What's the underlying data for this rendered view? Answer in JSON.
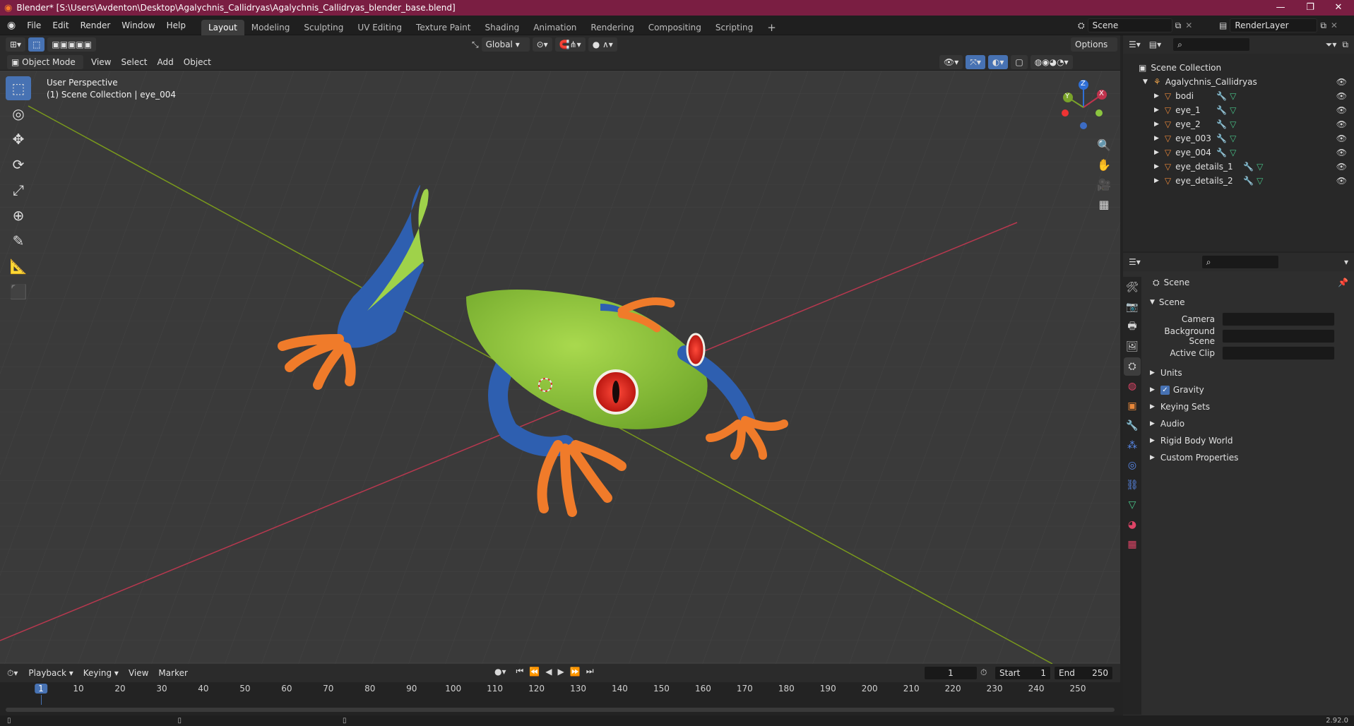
{
  "window": {
    "title": "Blender* [S:\\Users\\Avdenton\\Desktop\\Agalychnis_Callidryas\\Agalychnis_Callidryas_blender_base.blend]",
    "minimize": "—",
    "maximize": "❐",
    "close": "✕"
  },
  "menu": [
    "File",
    "Edit",
    "Render",
    "Window",
    "Help"
  ],
  "workspaces": [
    "Layout",
    "Modeling",
    "Sculpting",
    "UV Editing",
    "Texture Paint",
    "Shading",
    "Animation",
    "Rendering",
    "Compositing",
    "Scripting"
  ],
  "workspace_add": "+",
  "scene_selector": {
    "value": "Scene"
  },
  "view_layer": {
    "value": "RenderLayer"
  },
  "viewport_header": {
    "transform_orientation": "Global",
    "options": "Options",
    "mode": "Object Mode",
    "menus": [
      "View",
      "Select",
      "Add",
      "Object"
    ]
  },
  "viewport": {
    "perspective": "User Perspective",
    "collection_info": "(1) Scene Collection | eye_004",
    "gizmo": {
      "x": "X",
      "y": "Y",
      "z": "Z"
    }
  },
  "outliner": {
    "root": "Scene Collection",
    "collection": "Agalychnis_Callidryas",
    "items": [
      "bodi",
      "eye_1",
      "eye_2",
      "eye_003",
      "eye_004",
      "eye_details_1",
      "eye_details_2"
    ]
  },
  "properties": {
    "context": "Scene",
    "panel_title": "Scene",
    "fields": [
      {
        "label": "Camera",
        "value": ""
      },
      {
        "label": "Background Scene",
        "value": ""
      },
      {
        "label": "Active Clip",
        "value": ""
      }
    ],
    "sections": [
      "Units",
      "Gravity",
      "Keying Sets",
      "Audio",
      "Rigid Body World",
      "Custom Properties"
    ],
    "gravity_checked": true
  },
  "timeline": {
    "menus": [
      "Playback",
      "Keying",
      "View",
      "Marker"
    ],
    "current_frame": "1",
    "start_label": "Start",
    "start": "1",
    "end_label": "End",
    "end": "250",
    "ticks": [
      "1",
      "10",
      "20",
      "30",
      "40",
      "50",
      "60",
      "70",
      "80",
      "90",
      "100",
      "110",
      "120",
      "130",
      "140",
      "150",
      "160",
      "170",
      "180",
      "190",
      "200",
      "210",
      "220",
      "230",
      "240",
      "250"
    ]
  },
  "status": {
    "version": "2.92.0"
  },
  "colors": {
    "accent": "#4772b3",
    "titlebar": "#7a1e42",
    "x_axis": "#b8384f",
    "y_axis": "#7a9a1c",
    "frog_green": "#8cc63f"
  }
}
